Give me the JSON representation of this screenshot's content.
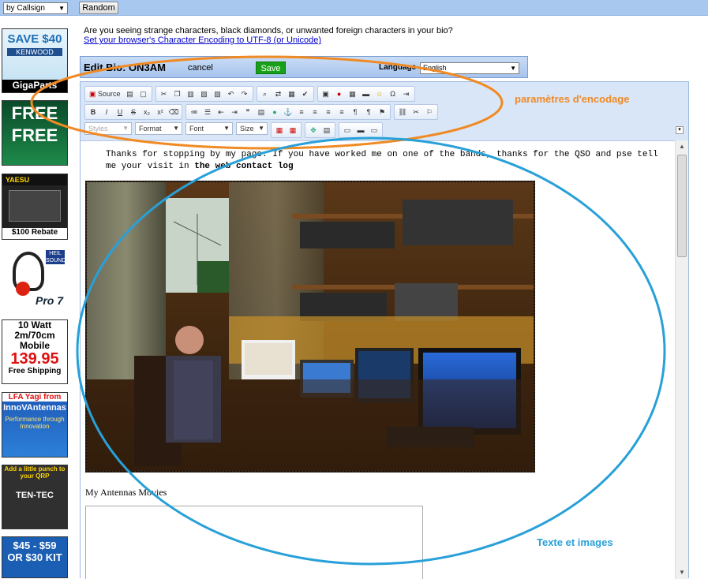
{
  "topbar": {
    "callsign_select": "by Callsign",
    "random_label": "Random"
  },
  "ads": {
    "ad1": {
      "line1": "SAVE $40",
      "line2": "KENWOOD",
      "line3": "GigaParts"
    },
    "ad2": {
      "line1": "FREE",
      "line2": "FREE"
    },
    "ad3": {
      "brand": "YAESU",
      "rebate": "$100 Rebate"
    },
    "ad4": {
      "logo": "HEIL SOUND",
      "model": "Pro 7"
    },
    "ad5": {
      "line1": "10 Watt",
      "line2": "2m/70cm",
      "line3": "Mobile",
      "price": "139.95",
      "shipping": "Free Shipping"
    },
    "ad6": {
      "line1": "LFA Yagi from",
      "line2": "InnoVAntennas",
      "line3": "Performance through Innovation"
    },
    "ad7": {
      "line1": "Add a little punch to your QRP",
      "brand": "TEN-TEC"
    },
    "ad8": {
      "line1": "$45 - $59",
      "line2": "OR $30 KIT"
    }
  },
  "notice": {
    "question": "Are you seeing strange characters, black diamonds, or unwanted foreign characters in your bio?",
    "link": "Set your browser's Character Encoding to UTF-8 (or Unicode)"
  },
  "editbar": {
    "title": "Edit Bio: ON3AM",
    "cancel": "cancel",
    "save": "Save",
    "language_label": "Language",
    "language_value": "English"
  },
  "toolbar": {
    "source": "Source",
    "styles": "Styles",
    "format": "Format",
    "font": "Font",
    "size": "Size"
  },
  "content": {
    "intro_part1": "Thanks for stopping by my page. If you have worked me on one of the bands, thanks for the QSO and pse tell me your visit in ",
    "intro_bold": "the web contact log",
    "movies_label": "My Antennas Movies"
  },
  "annotations": {
    "encoding": "paramètres d'encodage",
    "text_images": "Texte et images",
    "orange": "#f08a24",
    "blue": "#28a0d8"
  }
}
